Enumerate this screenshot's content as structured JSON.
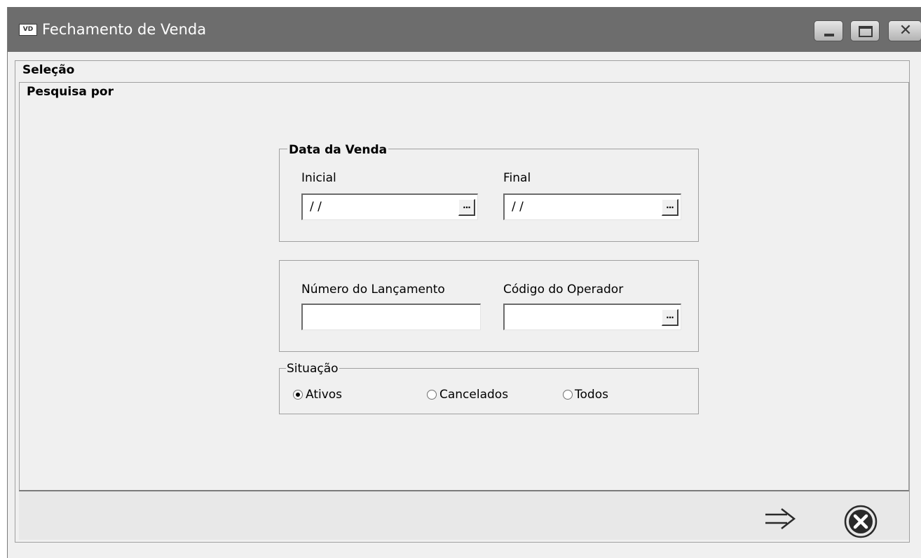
{
  "window": {
    "app_icon": "VD",
    "title": "Fechamento de Venda",
    "controls": {
      "minimize": "minimize-icon",
      "maximize": "maximize-icon",
      "close": "close-icon"
    }
  },
  "selecao": {
    "legend": "Seleção"
  },
  "pesquisa": {
    "legend": "Pesquisa por"
  },
  "data_venda": {
    "legend": "Data da Venda",
    "inicial": {
      "label": "Inicial",
      "value": "/ /",
      "button": "..."
    },
    "final": {
      "label": "Final",
      "value": "/ /",
      "button": "..."
    }
  },
  "lancamento": {
    "numero": {
      "label": "Número do Lançamento",
      "value": ""
    },
    "operador": {
      "label": "Código do Operador",
      "value": "",
      "button": "..."
    }
  },
  "situacao": {
    "legend": "Situação",
    "options": [
      {
        "label": "Ativos",
        "checked": true
      },
      {
        "label": "Cancelados",
        "checked": false
      },
      {
        "label": "Todos",
        "checked": false
      }
    ]
  },
  "footer": {
    "confirm_icon": "arrow-right-icon",
    "cancel_icon": "cancel-circle-icon"
  }
}
